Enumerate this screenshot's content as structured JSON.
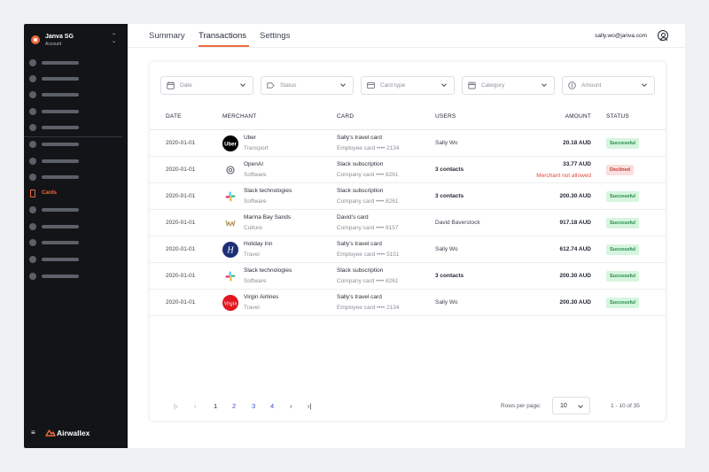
{
  "account": {
    "name": "Janva SG",
    "subtitle": "Account"
  },
  "sidebar": {
    "active_label": "Cards",
    "brand": "Airwallex"
  },
  "header": {
    "tabs": [
      "Summary",
      "Transactions",
      "Settings"
    ],
    "active_tab": "Transactions",
    "email": "sally.wo@janva.com"
  },
  "filters": [
    {
      "placeholder": "Date",
      "icon": "calendar-icon"
    },
    {
      "placeholder": "Status",
      "icon": "tag-icon"
    },
    {
      "placeholder": "Card type",
      "icon": "card-icon"
    },
    {
      "placeholder": "Category",
      "icon": "store-icon"
    },
    {
      "placeholder": "Amount",
      "icon": "currency-icon"
    }
  ],
  "table": {
    "headers": [
      "DATE",
      "MERCHANT",
      "CARD",
      "USERS",
      "AMOUNT",
      "STATUS"
    ],
    "rows": [
      {
        "date": "2020-01-01",
        "merchant": "Uber",
        "category": "Transport",
        "card": "Sally’s travel card",
        "card_number": "Employee card •••• 2134",
        "users": "Sally Wo",
        "amount": "20.18 AUD",
        "note": "",
        "status": "Successful"
      },
      {
        "date": "2020-01-01",
        "merchant": "OpenAI",
        "category": "Software",
        "card": "Slack subscription",
        "card_number": "Company card •••• 8261",
        "users": "3 contacts",
        "amount": "33.77 AUD",
        "note": "Merchant not allowed",
        "status": "Declined"
      },
      {
        "date": "2020-01-01",
        "merchant": "Slack technologies",
        "category": "Software",
        "card": "Slack subscription",
        "card_number": "Company card •••• 8261",
        "users": "3 contacts",
        "amount": "200.30 AUD",
        "note": "",
        "status": "Successful"
      },
      {
        "date": "2020-01-01",
        "merchant": "Marina Bay Sands",
        "category": "Culture",
        "card": "David’s card",
        "card_number": "Company card •••• 8157",
        "users": "David Baverstock",
        "amount": "917.18 AUD",
        "note": "",
        "status": "Successful"
      },
      {
        "date": "2020-01-01",
        "merchant": "Holiday Inn",
        "category": "Travel",
        "card": "Sally’s travel card",
        "card_number": "Employee card •••• 5151",
        "users": "Sally Wo",
        "amount": "612.74 AUD",
        "note": "",
        "status": "Successful"
      },
      {
        "date": "2020-01-01",
        "merchant": "Slack technologies",
        "category": "Software",
        "card": "Slack subscription",
        "card_number": "Company card •••• 8261",
        "users": "3 contacts",
        "amount": "200.30 AUD",
        "note": "",
        "status": "Successful"
      },
      {
        "date": "2020-01-01",
        "merchant": "Virgin Airlines",
        "category": "Travel",
        "card": "Sally’s travel card",
        "card_number": "Employee card •••• 2134",
        "users": "Sally Wo",
        "amount": "200.30 AUD",
        "note": "",
        "status": "Successful"
      }
    ]
  },
  "pagination": {
    "pages": [
      "1",
      "2",
      "3",
      "4"
    ],
    "current": "1",
    "rows_per_page_label": "Rows per page:",
    "rows_per_page": "10",
    "range": "1 - 10 of 35"
  },
  "colors": {
    "accent": "#ee6a3f",
    "sidebar": "#121417",
    "link": "#3b4fd1",
    "success_bg": "#d6f5df",
    "danger": "#e14b3b"
  }
}
